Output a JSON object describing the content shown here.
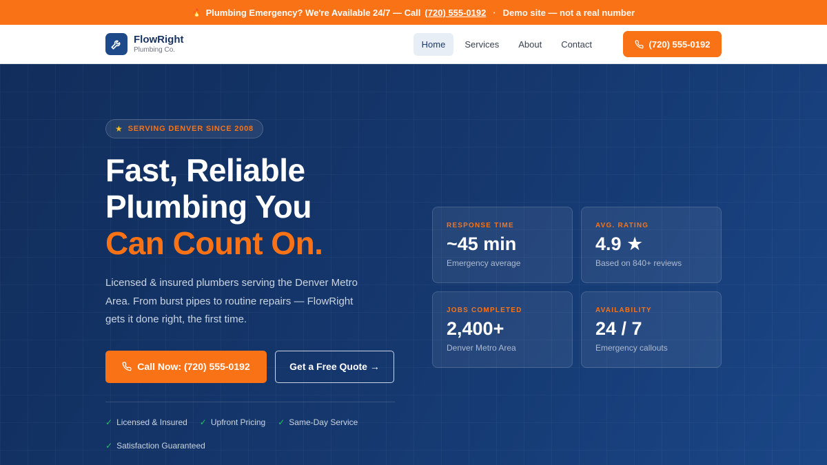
{
  "alert": {
    "icon": "fire-icon",
    "text": "Plumbing Emergency? We're Available 24/7 — Call",
    "phone": "(720) 555-0192",
    "separator": "·",
    "note": "Demo site — not a real number"
  },
  "nav": {
    "brand_name": "FlowRight",
    "brand_sub": "Plumbing Co.",
    "links": [
      "Home",
      "Services",
      "About",
      "Contact"
    ],
    "active": "Home",
    "cta_label": "(720) 555-0192"
  },
  "hero": {
    "badge": "SERVING DENVER SINCE 2008",
    "headline_line1": "Fast, Reliable",
    "headline_line2": "Plumbing You",
    "headline_accent": "Can Count On.",
    "lead": "Licensed & insured plumbers serving the Denver Metro Area. From burst pipes to routine repairs — FlowRight gets it done right, the first time.",
    "primary_cta": "Call Now: (720) 555-0192",
    "secondary_cta": "Get a Free Quote →",
    "checks": [
      "Licensed & Insured",
      "Upfront Pricing",
      "Same-Day Service",
      "Satisfaction Guaranteed"
    ]
  },
  "stats": [
    {
      "label": "RESPONSE TIME",
      "value": "~45 min",
      "sub": "Emergency average"
    },
    {
      "label": "AVG. RATING",
      "value": "4.9 ★",
      "sub": "Based on 840+ reviews"
    },
    {
      "label": "JOBS COMPLETED",
      "value": "2,400+",
      "sub": "Denver Metro Area"
    },
    {
      "label": "AVAILABILITY",
      "value": "24 / 7",
      "sub": "Emergency callouts"
    }
  ],
  "colors": {
    "accent": "#f97316",
    "navy": "#112d5b",
    "brand": "#1e4a8a",
    "check": "#22c55e"
  }
}
